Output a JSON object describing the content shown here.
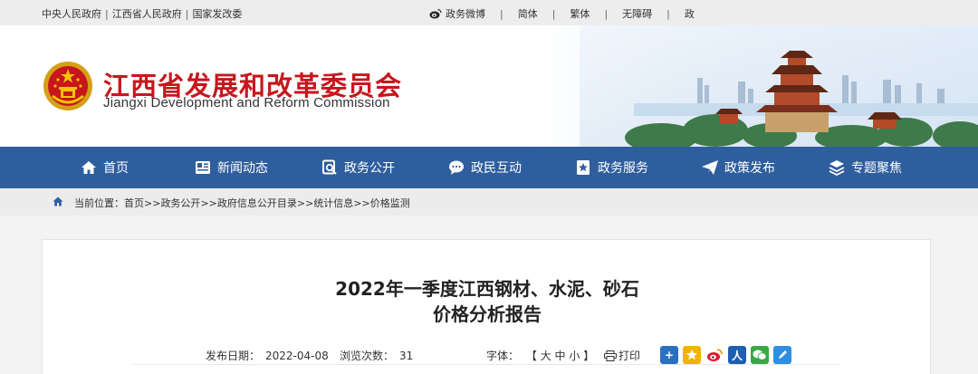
{
  "topbar": {
    "links": [
      "中央人民政府",
      "江西省人民政府",
      "国家发改委"
    ],
    "weibo": "政务微博",
    "simplified": "简体",
    "traditional": "繁体",
    "accessible": "无障碍",
    "gov": "政"
  },
  "header": {
    "title_cn": "江西省发展和改革委员会",
    "title_en": "Jiangxi Development and Reform Commission"
  },
  "nav": {
    "items": [
      {
        "label": "首页",
        "icon": "home-icon"
      },
      {
        "label": "新闻动态",
        "icon": "news-icon"
      },
      {
        "label": "政务公开",
        "icon": "search-doc-icon"
      },
      {
        "label": "政民互动",
        "icon": "chat-icon"
      },
      {
        "label": "政务服务",
        "icon": "star-bookmark-icon"
      },
      {
        "label": "政策发布",
        "icon": "paper-plane-icon"
      },
      {
        "label": "专题聚焦",
        "icon": "layers-icon"
      }
    ]
  },
  "breadcrumb": {
    "prefix": "当前位置：",
    "items": [
      "首页",
      "政务公开",
      "政府信息公开目录",
      "统计信息",
      "价格监测"
    ],
    "separator": ">>"
  },
  "article": {
    "title_line1": "2022年一季度江西钢材、水泥、砂石",
    "title_line2": "价格分析报告",
    "date_label": "发布日期：",
    "date": "2022-04-08",
    "views_label": "浏览次数：",
    "views": "31",
    "font_label": "字体：",
    "font_open": "【",
    "font_large": "大",
    "font_medium": "中",
    "font_small": "小",
    "font_close": "】",
    "print_label": "打印"
  },
  "share": {
    "icons": [
      "plus-share-icon",
      "qzone-icon",
      "weibo-icon",
      "renren-icon",
      "wechat-icon",
      "note-icon"
    ],
    "colors": [
      "#2b6fc0",
      "#f2b300",
      "#e6162d",
      "#1c5fb0",
      "#3aa845",
      "#2e8fe0"
    ]
  },
  "colors": {
    "nav_bg": "#2f5e9e",
    "title_red": "#c8161d"
  }
}
